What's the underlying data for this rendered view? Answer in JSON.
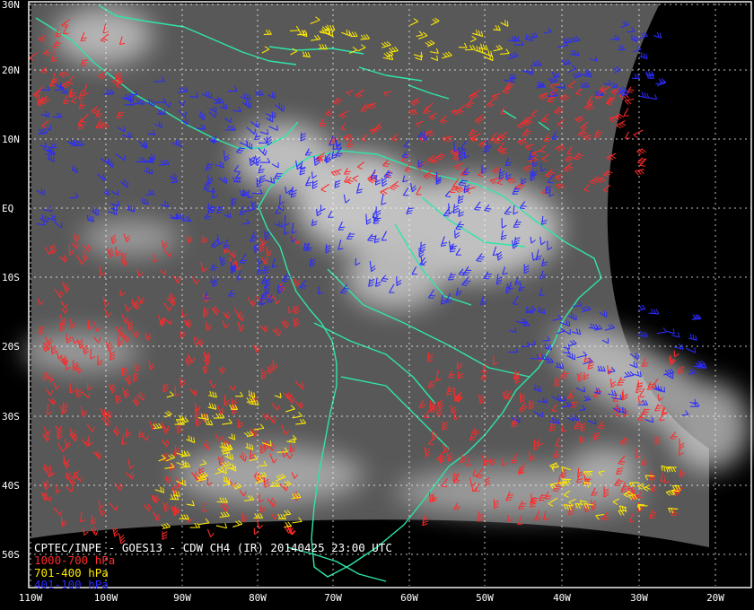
{
  "map": {
    "title": "CPTEC/INPE - GOES13 - CDW CH4 (IR) 20140425 23:00 UTC",
    "lat_labels": [
      "30N",
      "20N",
      "10N",
      "EQ",
      "10S",
      "20S",
      "30S",
      "40S",
      "50S"
    ],
    "lon_labels": [
      "110W",
      "100W",
      "90W",
      "80W",
      "70W",
      "60W",
      "50W",
      "40W",
      "30W",
      "20W"
    ],
    "legend": [
      {
        "label": "1000-700 hPa",
        "color": "#ff2a2a"
      },
      {
        "label": "701-400 hPa",
        "color": "#ffea00"
      },
      {
        "label": "401-100 hPa",
        "color": "#2b2bff"
      }
    ],
    "colors": {
      "background": "#000000",
      "satellite_base": "#585858",
      "coastline": "#2ee6a8",
      "grid": "#ffffff",
      "border": "#ffffff",
      "text": "#ffffff"
    }
  }
}
